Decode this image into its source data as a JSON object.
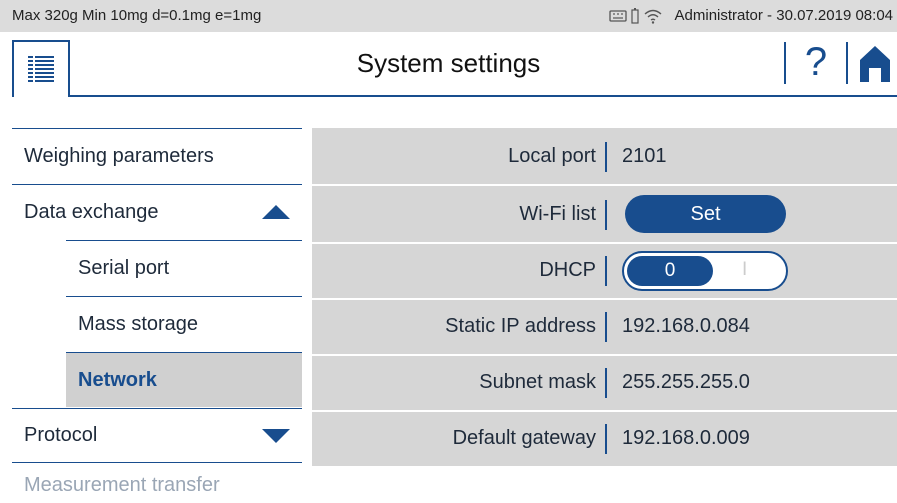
{
  "status_bar": {
    "scale_info": "Max 320g  Min 10mg  d=0.1mg  e=1mg",
    "user_datetime": "Administrator - 30.07.2019 08:04"
  },
  "header": {
    "title": "System settings",
    "help_label": "?"
  },
  "nav": {
    "items": [
      {
        "label": "Weighing parameters"
      },
      {
        "label": "Data exchange"
      },
      {
        "label": "Serial port"
      },
      {
        "label": "Mass storage"
      },
      {
        "label": "Network"
      },
      {
        "label": "Protocol"
      },
      {
        "label": "Measurement transfer"
      }
    ]
  },
  "settings": {
    "rows": [
      {
        "label": "Local port",
        "value": "2101"
      },
      {
        "label": "Wi-Fi list",
        "button": "Set"
      },
      {
        "label": "DHCP",
        "toggle_on": "0",
        "toggle_off": "I"
      },
      {
        "label": "Static IP address",
        "value": "192.168.0.084"
      },
      {
        "label": "Subnet mask",
        "value": "255.255.255.0"
      },
      {
        "label": "Default gateway",
        "value": "192.168.0.009"
      }
    ]
  },
  "colors": {
    "accent": "#184d8e",
    "panel_bg": "#d6d6d6",
    "status_bg": "#dcdcdc"
  }
}
